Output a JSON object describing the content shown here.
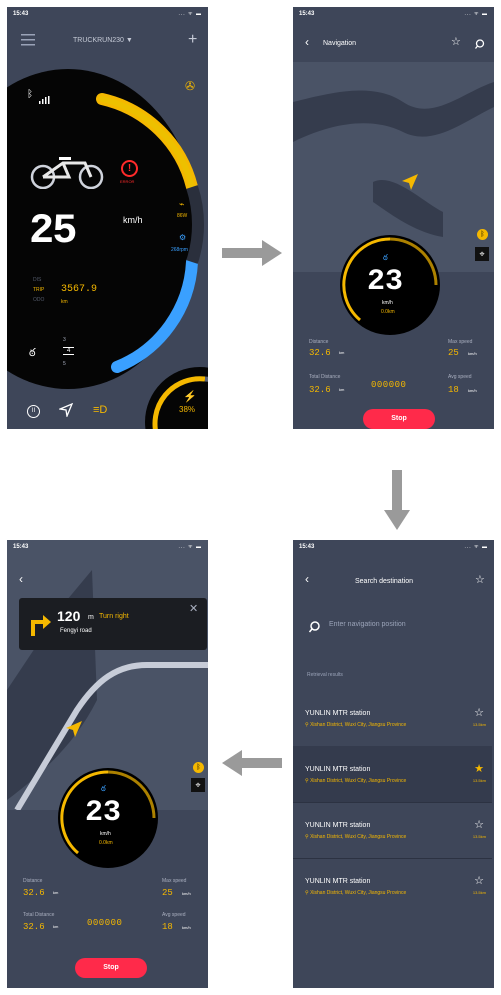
{
  "status_time": "15:43",
  "status_icons": "... ᯤ ▬",
  "screen1": {
    "device_name": "TRUCKRUN230 ▼",
    "speed": "25",
    "speed_unit": "km/h",
    "alert_label": "ERROR",
    "power_value": "86W",
    "rpm_value": "268rpm",
    "dis_label": "DIS",
    "trip_label": "TRIP",
    "odo_label": "ODO",
    "trip_value": "3567.9",
    "trip_unit": "km",
    "gear_top": "3",
    "gear_mid": "4",
    "gear_bottom": "5",
    "battery_percent": "38%",
    "colors": {
      "accent": "#f5b800",
      "blue": "#3aa0ff",
      "red": "#ff2a2a"
    }
  },
  "screen2": {
    "title": "Navigation",
    "speed": "23",
    "speed_unit": "km/h",
    "distance": "0.0km",
    "left_label_1": "Distance",
    "left_value_1": "32.6",
    "left_unit_1": "km",
    "left_label_2": "Total Distance",
    "left_value_2": "32.6",
    "left_unit_2": "km",
    "center_value": "000000",
    "right_label_1": "Max speed",
    "right_value_1": "25",
    "right_unit_1": "km/h",
    "right_label_2": "Avg speed",
    "right_value_2": "18",
    "right_unit_2": "km/h",
    "stop_label": "Stop"
  },
  "screen3": {
    "title": "Search destination",
    "search_placeholder": "Enter navigation position",
    "results_label": "Retrieval results",
    "items": [
      {
        "title": "YUNLIN MTR station",
        "sub": "Xishan District, Wuxi City, Jiangsu Province",
        "dist": "13.5km",
        "starred": false
      },
      {
        "title": "YUNLIN MTR station",
        "sub": "Xishan District, Wuxi City, Jiangsu Province",
        "dist": "13.5km",
        "starred": true
      },
      {
        "title": "YUNLIN MTR station",
        "sub": "Xishan District, Wuxi City, Jiangsu Province",
        "dist": "13.5km",
        "starred": false
      },
      {
        "title": "YUNLIN MTR station",
        "sub": "Xishan District, Wuxi City, Jiangsu Province",
        "dist": "13.5km",
        "starred": false
      }
    ]
  },
  "screen4": {
    "turn_distance": "120",
    "turn_unit": "m",
    "turn_text": "Turn right",
    "road_name": "Fengyi road",
    "speed": "23",
    "speed_unit": "km/h",
    "distance": "0.0km",
    "left_label_1": "Distance",
    "left_value_1": "32.6",
    "left_unit_1": "km",
    "left_label_2": "Total Distance",
    "left_value_2": "32.6",
    "left_unit_2": "km",
    "center_value": "000000",
    "right_label_1": "Max speed",
    "right_value_1": "25",
    "right_unit_1": "km/h",
    "right_label_2": "Avg speed",
    "right_value_2": "18",
    "right_unit_2": "km/h",
    "stop_label": "Stop"
  }
}
